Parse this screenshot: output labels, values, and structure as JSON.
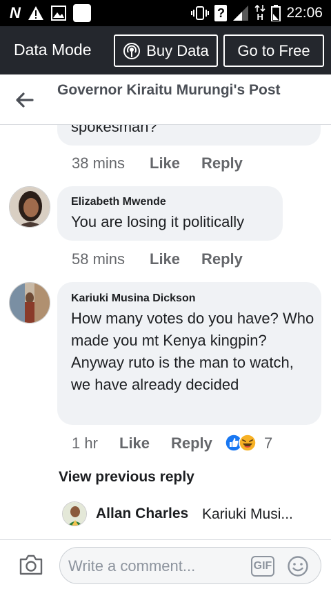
{
  "status_bar": {
    "time": "22:06",
    "left_icons": [
      "n-icon",
      "warning-icon",
      "image-icon",
      "square-icon"
    ],
    "right_icons": [
      "vibrate-icon",
      "sim-unknown-icon",
      "signal-icon",
      "data-h-icon",
      "battery-icon"
    ],
    "network_letter": "H",
    "sim_letter": "?"
  },
  "data_bar": {
    "title": "Data Mode",
    "buy_label": "Buy Data",
    "free_label": "Go to Free"
  },
  "header": {
    "title": "Governor Kiraitu Murungi's Post"
  },
  "comments": [
    {
      "text": "spokesman?",
      "time": "38 mins",
      "like": "Like",
      "reply": "Reply"
    },
    {
      "name": "Elizabeth Mwende",
      "text": "You are losing it politically",
      "time": "58 mins",
      "like": "Like",
      "reply": "Reply"
    },
    {
      "name": "Kariuki Musina Dickson",
      "text": "How many votes do you have? Who made you mt Kenya kingpin? Anyway ruto is the man to watch, we have already decided",
      "time": "1 hr",
      "like": "Like",
      "reply": "Reply",
      "reaction_count": "7"
    }
  ],
  "view_previous": "View previous reply",
  "reply_preview": {
    "name": "Allan Charles",
    "snippet": "Kariuki Musi..."
  },
  "composer": {
    "placeholder": "Write a comment...",
    "gif_label": "GIF"
  },
  "colors": {
    "accent": "#1877f2",
    "data_bar": "#24272d",
    "bubble": "#f0f2f5"
  }
}
